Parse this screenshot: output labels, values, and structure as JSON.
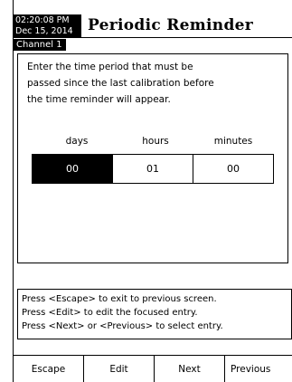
{
  "header": {
    "time": "02:20:08 PM",
    "date": "Dec 15, 2014",
    "title": "Periodic Reminder"
  },
  "channel": "Channel 1",
  "panel": {
    "description": [
      "Enter the time period that must be",
      "passed since the last calibration before",
      "the time reminder will appear."
    ],
    "fields": [
      {
        "label": "days",
        "value": "00",
        "focused": true
      },
      {
        "label": "hours",
        "value": "01",
        "focused": false
      },
      {
        "label": "minutes",
        "value": "00",
        "focused": false
      }
    ]
  },
  "help": [
    "Press <Escape> to exit to previous screen.",
    "Press <Edit> to edit the focused entry.",
    "Press <Next> or <Previous> to select entry."
  ],
  "softkeys": [
    "Escape",
    "Edit",
    "Next",
    "Previous"
  ]
}
